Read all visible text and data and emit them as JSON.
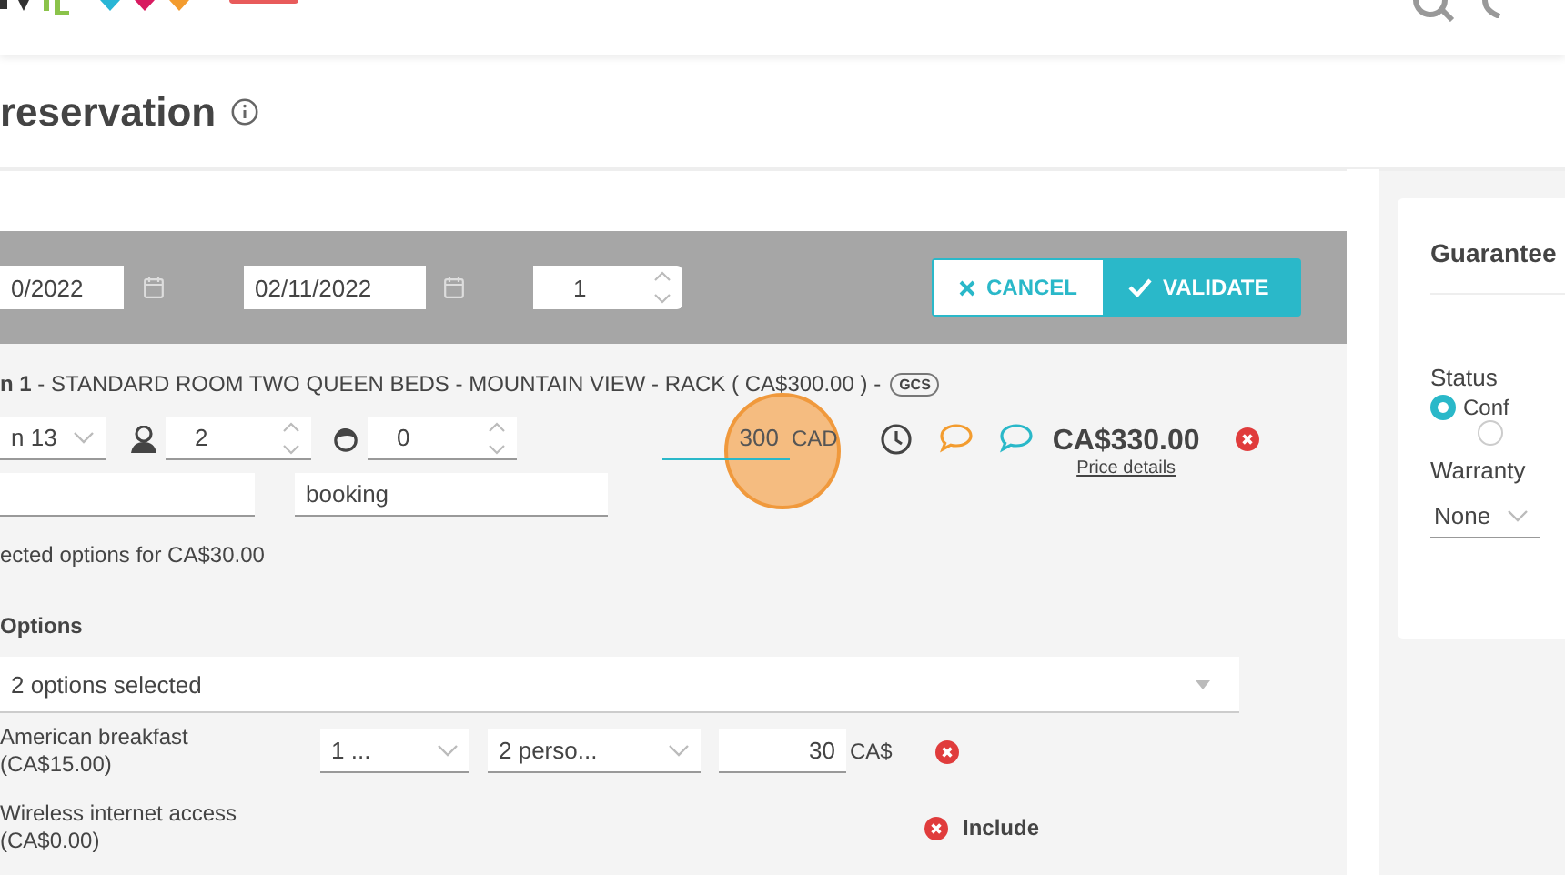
{
  "page_title": "reservation",
  "booking_bar": {
    "arrival": "0/2022",
    "departure": "02/11/2022",
    "rooms": "1",
    "buttons": [
      {
        "kind": "cancel",
        "label": "CANCEL"
      },
      {
        "kind": "validate",
        "label": "VALIDATE"
      }
    ]
  },
  "room": {
    "heading": "**n 1** - STANDARD ROOM TWO QUEEN BEDS - MOUNTAIN VIEW - RACK ( CA$300.00 ) -",
    "rate_tag": "GCS",
    "room_select": "n 13",
    "adults": "2",
    "children": "0",
    "price": "300",
    "currency": "CAD",
    "total": "CA$330.00",
    "price_details": "Price details",
    "reference": "booking",
    "options_summary": "ected options for CA$30.00",
    "options_title": "Options",
    "options_select": "2 options selected",
    "options": [
      {
        "kind": "priced",
        "name": "American breakfast",
        "price_label": "(CA$15.00)",
        "quantity": "1 ...",
        "persons": "2 perso...",
        "amount": "30",
        "currency": "CA$"
      },
      {
        "kind": "included",
        "name": "Wireless internet access",
        "price_label": "(CA$0.00)",
        "action": "Include"
      }
    ]
  },
  "guarantee": {
    "title": "Guarantee",
    "status_label": "Status",
    "statuses": [
      {
        "label": "Conf",
        "selected": true
      },
      {
        "selected": false
      }
    ],
    "warranty_label": "Warranty",
    "warranty": "None"
  }
}
